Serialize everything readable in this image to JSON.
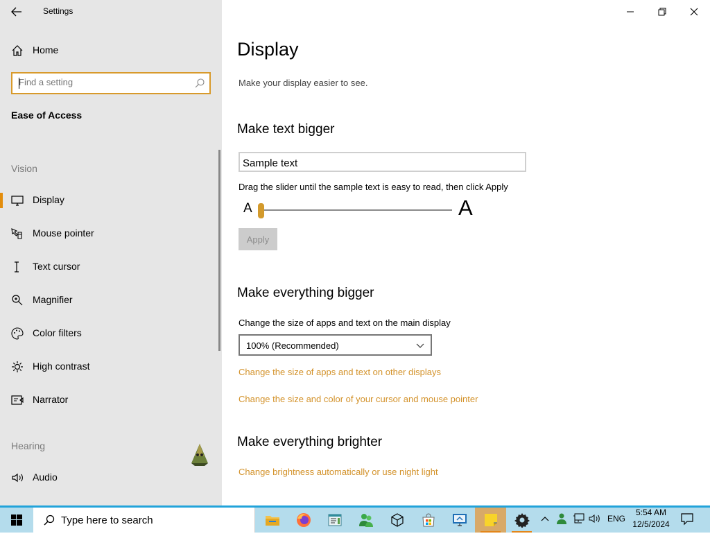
{
  "window": {
    "title": "Settings",
    "back_label": "←"
  },
  "sidebar": {
    "home_label": "Home",
    "search": {
      "placeholder": "Find a setting"
    },
    "group_title": "Ease of Access",
    "sections": [
      {
        "label": "Vision"
      },
      {
        "label": "Hearing"
      }
    ],
    "items": [
      {
        "label": "Display",
        "icon": "monitor-icon",
        "selected": true
      },
      {
        "label": "Mouse pointer",
        "icon": "mouse-pointer-icon",
        "selected": false
      },
      {
        "label": "Text cursor",
        "icon": "text-cursor-icon",
        "selected": false
      },
      {
        "label": "Magnifier",
        "icon": "magnifier-icon",
        "selected": false
      },
      {
        "label": "Color filters",
        "icon": "color-filters-icon",
        "selected": false
      },
      {
        "label": "High contrast",
        "icon": "high-contrast-icon",
        "selected": false
      },
      {
        "label": "Narrator",
        "icon": "narrator-icon",
        "selected": false
      },
      {
        "label": "Audio",
        "icon": "audio-icon",
        "selected": false
      }
    ]
  },
  "main": {
    "title": "Display",
    "subtitle": "Make your display easier to see.",
    "text_bigger": {
      "heading": "Make text bigger",
      "sample_text": "Sample text",
      "instruction": "Drag the slider until the sample text is easy to read, then click Apply",
      "slider_min_label": "A",
      "slider_max_label": "A",
      "slider_value": 0,
      "apply_label": "Apply"
    },
    "everything_bigger": {
      "heading": "Make everything bigger",
      "label": "Change the size of apps and text on the main display",
      "selected_option": "100% (Recommended)",
      "link_other_displays": "Change the size of apps and text on other displays",
      "link_cursor": "Change the size and color of your cursor and mouse pointer"
    },
    "everything_brighter": {
      "heading": "Make everything brighter",
      "link_brightness": "Change brightness automatically or use night light"
    }
  },
  "taskbar": {
    "search_placeholder": "Type here to search",
    "apps": [
      "file-explorer-icon",
      "firefox-icon",
      "notepad-icon",
      "people-icon",
      "3d-viewer-icon",
      "store-icon",
      "remote-desktop-icon",
      "sticky-notes-icon",
      "settings-icon"
    ],
    "tray": {
      "language": "ENG",
      "time": "5:54 AM",
      "date": "12/5/2024"
    }
  },
  "colors": {
    "accent": "#d3922a",
    "sidebar_bg": "#e6e6e6",
    "taskbar_bg": "#b4dcec",
    "taskbar_border": "#22a3da"
  }
}
